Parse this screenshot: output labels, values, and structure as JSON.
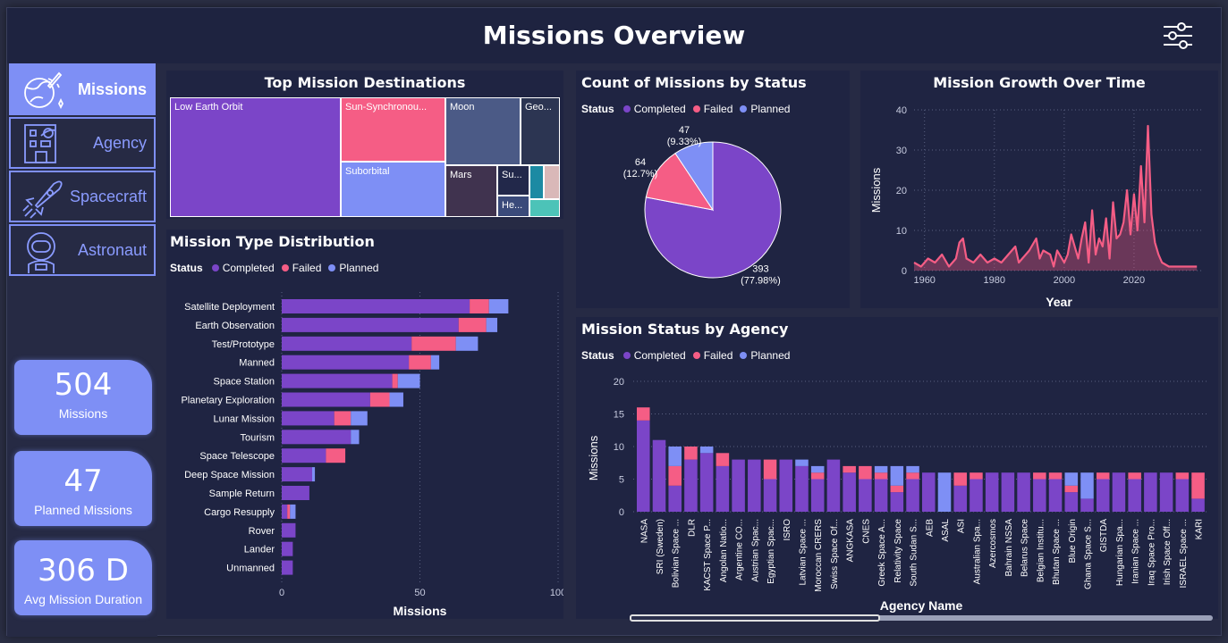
{
  "header": {
    "title": "Missions Overview"
  },
  "nav": [
    {
      "label": "Missions",
      "icon": "planet-rocket-icon",
      "active": true
    },
    {
      "label": "Agency",
      "icon": "building-icon",
      "active": false
    },
    {
      "label": "Spacecraft",
      "icon": "rocket-icon",
      "active": false
    },
    {
      "label": "Astronaut",
      "icon": "astronaut-icon",
      "active": false
    }
  ],
  "kpis": [
    {
      "value": "504",
      "caption": "Missions"
    },
    {
      "value": "47",
      "caption": "Planned Missions"
    },
    {
      "value": "306 D",
      "caption": "Avg Mission Duration"
    }
  ],
  "colors": {
    "completed": "#7b45c8",
    "failed": "#f55d85",
    "planned": "#7e8ff5"
  },
  "treemap": {
    "title": "Top Mission Destinations",
    "tiles": [
      {
        "label": "Low Earth Orbit",
        "color": "#7b45c8"
      },
      {
        "label": "Sun-Synchronou...",
        "color": "#f55d85"
      },
      {
        "label": "Moon",
        "color": "#4b5a86"
      },
      {
        "label": "Geo...",
        "color": "#2c3552"
      },
      {
        "label": "Suborbital",
        "color": "#7e8ff5"
      },
      {
        "label": "Mars",
        "color": "#40334f"
      },
      {
        "label": "Su...",
        "color": "#22284a"
      },
      {
        "label": "He...",
        "color": "#3a4a7a"
      },
      {
        "label": "",
        "color": "#1c8aa3"
      },
      {
        "label": "",
        "color": "#d9b8b8"
      },
      {
        "label": "",
        "color": "#4cc3b8"
      }
    ]
  },
  "legend": {
    "status": "Status",
    "completed": "Completed",
    "failed": "Failed",
    "planned": "Planned"
  },
  "chart_data": [
    {
      "type": "bar",
      "orientation": "horizontal",
      "stacked": true,
      "title": "Mission Type Distribution",
      "xlabel": "Missions",
      "xlim": [
        0,
        100
      ],
      "xticks": [
        0,
        50,
        100
      ],
      "categories": [
        "Satellite Deployment",
        "Earth Observation",
        "Test/Prototype",
        "Manned",
        "Space Station",
        "Planetary Exploration",
        "Lunar Mission",
        "Tourism",
        "Space Telescope",
        "Deep Space Mission",
        "Sample Return",
        "Cargo Resupply",
        "Rover",
        "Lander",
        "Unmanned"
      ],
      "series": [
        {
          "name": "Completed",
          "values": [
            68,
            64,
            47,
            46,
            40,
            32,
            19,
            25,
            16,
            11,
            10,
            2,
            5,
            4,
            4
          ]
        },
        {
          "name": "Failed",
          "values": [
            7,
            10,
            16,
            8,
            2,
            7,
            6,
            0,
            7,
            0,
            0,
            1,
            0,
            0,
            0
          ]
        },
        {
          "name": "Planned",
          "values": [
            7,
            4,
            8,
            3,
            8,
            5,
            6,
            3,
            0,
            1,
            0,
            2,
            0,
            0,
            0
          ]
        }
      ]
    },
    {
      "type": "pie",
      "title": "Count of Missions by Status",
      "labels": [
        "Completed",
        "Failed",
        "Planned"
      ],
      "values": [
        393,
        64,
        47
      ],
      "percent_labels": [
        "393\n(77.98%)",
        "64\n(12.7%)",
        "47\n(9.33%)"
      ]
    },
    {
      "type": "area",
      "title": "Mission Growth Over Time",
      "xlabel": "Year",
      "ylabel": "Missions",
      "xlim": [
        1957,
        2040
      ],
      "ylim": [
        0,
        40
      ],
      "xticks": [
        1960,
        1980,
        2000,
        2020
      ],
      "yticks": [
        0,
        10,
        20,
        30,
        40
      ],
      "x": [
        1957,
        1959,
        1961,
        1963,
        1965,
        1967,
        1969,
        1970,
        1971,
        1972,
        1974,
        1976,
        1978,
        1980,
        1982,
        1984,
        1986,
        1987,
        1988,
        1990,
        1992,
        1993,
        1994,
        1996,
        1997,
        1998,
        2000,
        2001,
        2002,
        2003,
        2004,
        2005,
        2006,
        2007,
        2008,
        2009,
        2010,
        2011,
        2012,
        2013,
        2014,
        2015,
        2016,
        2017,
        2018,
        2019,
        2020,
        2021,
        2022,
        2023,
        2024,
        2025,
        2026,
        2027,
        2028,
        2030,
        2033,
        2036,
        2038
      ],
      "y": [
        2,
        1,
        3,
        2,
        4,
        1,
        3,
        7,
        8,
        3,
        2,
        4,
        2,
        3,
        2,
        4,
        6,
        2,
        3,
        5,
        8,
        3,
        5,
        4,
        1,
        5,
        2,
        4,
        9,
        6,
        3,
        8,
        12,
        2,
        15,
        4,
        8,
        6,
        13,
        3,
        17,
        8,
        9,
        12,
        20,
        9,
        19,
        10,
        26,
        12,
        36,
        14,
        7,
        4,
        2,
        1,
        1,
        1,
        1
      ]
    },
    {
      "type": "bar",
      "stacked": true,
      "title": "Mission Status by Agency",
      "xlabel": "Agency Name",
      "ylabel": "Missions",
      "ylim": [
        0,
        20
      ],
      "yticks": [
        0,
        5,
        10,
        15,
        20
      ],
      "categories": [
        "NASA",
        "SRI (Sweden)",
        "Bolivian Space ...",
        "DLR",
        "KACST Space P...",
        "Angolan Natio...",
        "Argentine CO...",
        "Austrian Spac...",
        "Egyptian Spac...",
        "ISRO",
        "Latvian Space ...",
        "Moroccan CRERS",
        "Swiss Space Of...",
        "ANGKASA",
        "CNES",
        "Greek Space A...",
        "Relativity Space",
        "South Sudan S...",
        "AEB",
        "ASAL",
        "ASI",
        "Australian Spa...",
        "Azercosmos",
        "Bahrain NSSA",
        "Belarus Space",
        "Belgian Institu...",
        "Bhutan Space ...",
        "Blue Origin",
        "Ghana Space S...",
        "GISTDA",
        "Hungarian Spa...",
        "Iranian Space ...",
        "Iraq Space Pro...",
        "Irish Space Off...",
        "ISRAEL Space ...",
        "KARI"
      ],
      "series": [
        {
          "name": "Completed",
          "values": [
            14,
            11,
            4,
            8,
            9,
            7,
            8,
            8,
            5,
            8,
            7,
            5,
            8,
            6,
            5,
            5,
            3,
            5,
            6,
            0,
            4,
            5,
            6,
            6,
            6,
            5,
            5,
            3,
            2,
            5,
            6,
            5,
            6,
            6,
            5,
            2
          ]
        },
        {
          "name": "Failed",
          "values": [
            2,
            0,
            3,
            2,
            0,
            2,
            0,
            0,
            3,
            0,
            0,
            1,
            0,
            1,
            2,
            1,
            1,
            1,
            0,
            0,
            2,
            1,
            0,
            0,
            0,
            1,
            1,
            1,
            0,
            1,
            0,
            1,
            0,
            0,
            1,
            4
          ]
        },
        {
          "name": "Planned",
          "values": [
            0,
            0,
            3,
            0,
            1,
            0,
            0,
            0,
            0,
            0,
            1,
            1,
            0,
            0,
            0,
            1,
            3,
            1,
            0,
            6,
            0,
            0,
            0,
            0,
            0,
            0,
            0,
            2,
            4,
            0,
            0,
            0,
            0,
            0,
            0,
            0
          ]
        }
      ]
    }
  ]
}
